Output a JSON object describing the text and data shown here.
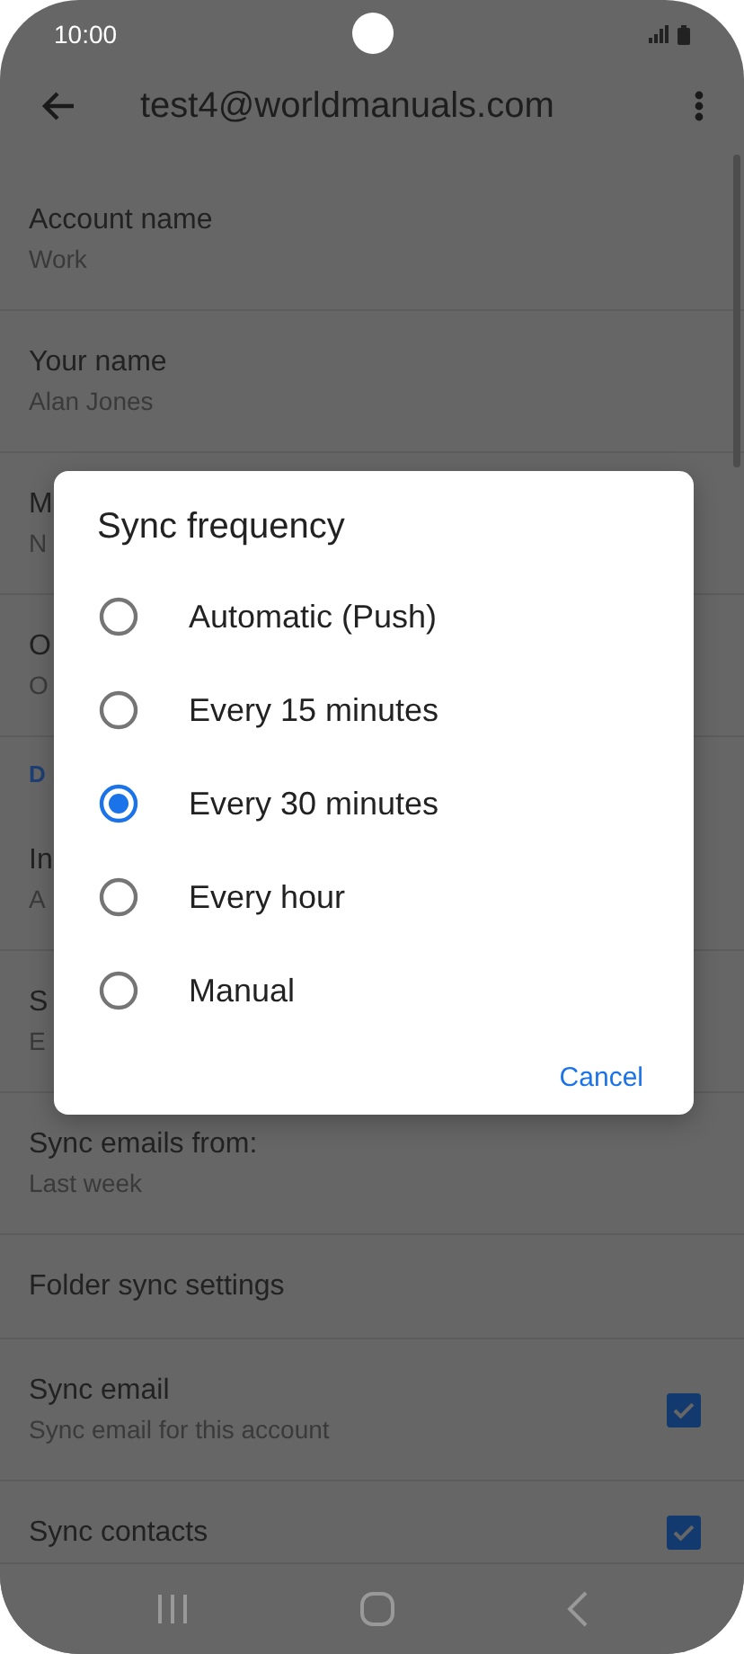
{
  "status_bar": {
    "time": "10:00"
  },
  "app_bar": {
    "title": "test4@worldmanuals.com"
  },
  "settings": [
    {
      "kind": "item",
      "title": "Account name",
      "subtitle": "Work"
    },
    {
      "kind": "item",
      "title": "Your name",
      "subtitle": "Alan Jones"
    },
    {
      "kind": "item",
      "title": "M",
      "subtitle": "N"
    },
    {
      "kind": "item",
      "title": "O",
      "subtitle": "O"
    },
    {
      "kind": "header",
      "title": "D"
    },
    {
      "kind": "item",
      "title": "In",
      "subtitle": "A"
    },
    {
      "kind": "item",
      "title": "S",
      "subtitle": "E"
    },
    {
      "kind": "item",
      "title": "Sync emails from:",
      "subtitle": "Last week"
    },
    {
      "kind": "item",
      "title": "Folder sync settings"
    },
    {
      "kind": "checkbox",
      "title": "Sync email",
      "subtitle": "Sync email for this account",
      "checked": true
    },
    {
      "kind": "checkbox",
      "title": "Sync contacts",
      "checked": true
    }
  ],
  "dialog": {
    "title": "Sync frequency",
    "options": [
      {
        "label": "Automatic (Push)",
        "selected": false
      },
      {
        "label": "Every 15 minutes",
        "selected": false
      },
      {
        "label": "Every 30 minutes",
        "selected": true
      },
      {
        "label": "Every hour",
        "selected": false
      },
      {
        "label": "Manual",
        "selected": false
      }
    ],
    "button": "Cancel"
  }
}
